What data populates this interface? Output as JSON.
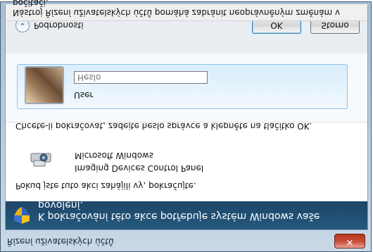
{
  "window": {
    "title": "Řízení uživatelských účtů",
    "close_symbol": "✕"
  },
  "banner": {
    "text": "K pokračování této akce potřebuje systém Windows vaše povolení.",
    "icon": "uac-shield-icon"
  },
  "body": {
    "line1": "Pokud jste tuto akci zahájili vy, pokračujte.",
    "program_name": "Imaging Devices Control Panel",
    "program_publisher": "Microsoft Windows",
    "instruction": "Chcete-li pokračovat, zadejte heslo správce a klepněte na tlačítko OK."
  },
  "credentials": {
    "user_label": "User",
    "password_placeholder": "Heslo"
  },
  "footer": {
    "details_label": "Podrobnosti",
    "ok_label": "OK",
    "cancel_label": "Storno",
    "info_text": "Nástroj Řízení uživatelských účtů pomáhá zabránit neoprávněným změnám v počítači."
  }
}
